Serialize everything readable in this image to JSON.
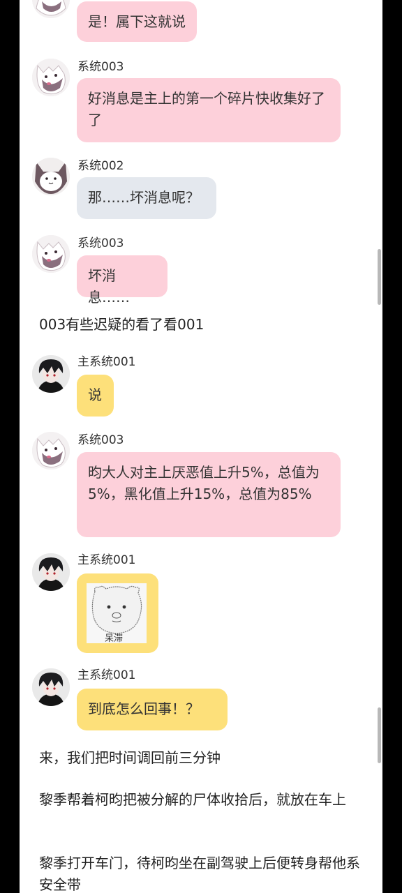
{
  "messages": [
    {
      "sender": "",
      "avatar": "wolf-icon",
      "text": "是！属下这就说",
      "color": "pink"
    },
    {
      "sender": "系统003",
      "avatar": "wolf-icon",
      "text": "好消息是主上的第一个碎片快收集好了了",
      "color": "pink"
    },
    {
      "sender": "系统002",
      "avatar": "dog-icon",
      "text": "那……坏消息呢？",
      "color": "gray"
    },
    {
      "sender": "系统003",
      "avatar": "wolf-icon",
      "text": "坏消息……",
      "color": "pink"
    },
    {
      "sender": "主系统001",
      "avatar": "dark-hair-boy-icon",
      "text": "说",
      "color": "yellow"
    },
    {
      "sender": "系统003",
      "avatar": "wolf-icon",
      "text": "昀大人对主上厌恶值上升5%，总值为5%，黑化值上升15%，总值为85%",
      "color": "pink"
    },
    {
      "sender": "主系统001",
      "avatar": "dark-hair-boy-icon",
      "sticker_caption": "呆滞",
      "color": "yellow"
    },
    {
      "sender": "主系统001",
      "avatar": "dark-hair-boy-icon",
      "text": "到底怎么回事！？",
      "color": "yellow"
    }
  ],
  "narration": [
    "003有些迟疑的看了看001",
    "来，我们把时间调回前三分钟",
    "黎季帮着柯昀把被分解的尸体收拾后，就放在车上",
    "黎季打开车门，待柯昀坐在副驾驶上后便转身帮他系安全带"
  ],
  "colors": {
    "pink": "#fdd0da",
    "gray": "#e4e8ee",
    "yellow": "#fde07a"
  }
}
